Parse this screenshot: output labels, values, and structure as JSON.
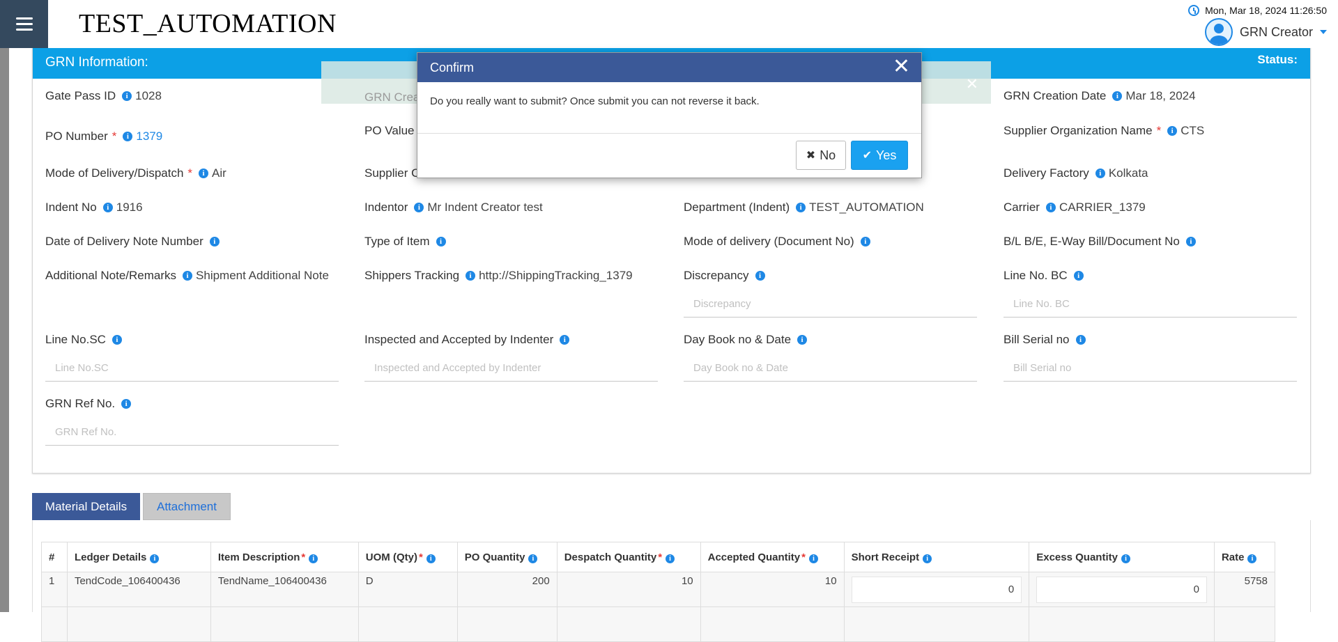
{
  "app": {
    "title": "TEST_AUTOMATION",
    "datetime": "Mon, Mar 18, 2024 11:26:50",
    "user": "GRN Creator"
  },
  "panel": {
    "title": "GRN Information:",
    "status_label": "Status:"
  },
  "alert": {
    "text": "GRN Creat"
  },
  "fields": {
    "gate_pass": {
      "label": "Gate Pass ID",
      "value": "1028"
    },
    "grn_creation_date": {
      "label": "GRN Creation Date",
      "value": "Mar 18, 2024"
    },
    "po_number": {
      "label": "PO Number",
      "value": "1379"
    },
    "po_value": {
      "label": "PO Value"
    },
    "supplier_org": {
      "label": "Supplier Organization Name",
      "value": "CTS"
    },
    "mode_delivery": {
      "label": "Mode of Delivery/Dispatch",
      "value": "Air"
    },
    "supplier_c": {
      "label": "Supplier C"
    },
    "delivery_factory": {
      "label": "Delivery Factory",
      "value": "Kolkata"
    },
    "indent_no": {
      "label": "Indent No",
      "value": "1916"
    },
    "indentor": {
      "label": "Indentor",
      "value": "Mr Indent Creator test"
    },
    "department": {
      "label": "Department (Indent)",
      "value": "TEST_AUTOMATION"
    },
    "carrier": {
      "label": "Carrier",
      "value": "CARRIER_1379"
    },
    "delivery_note": {
      "label": "Date of Delivery Note Number"
    },
    "type_item": {
      "label": "Type of Item"
    },
    "mode_doc": {
      "label": "Mode of delivery (Document No)"
    },
    "bl_be": {
      "label": "B/L B/E, E-Way Bill/Document No"
    },
    "additional_note": {
      "label": "Additional Note/Remarks",
      "value": "Shipment Additional Note"
    },
    "shippers_tracking": {
      "label": "Shippers Tracking",
      "value": "http://ShippingTracking_1379"
    },
    "discrepancy": {
      "label": "Discrepancy",
      "placeholder": "Discrepancy"
    },
    "line_bc": {
      "label": "Line No. BC",
      "placeholder": "Line No. BC"
    },
    "line_sc": {
      "label": "Line No.SC",
      "placeholder": "Line No.SC"
    },
    "inspected": {
      "label": "Inspected and Accepted by Indenter",
      "placeholder": "Inspected and Accepted by Indenter"
    },
    "day_book": {
      "label": "Day Book no & Date",
      "placeholder": "Day Book no & Date"
    },
    "bill_serial": {
      "label": "Bill Serial no",
      "placeholder": "Bill Serial no"
    },
    "grn_ref": {
      "label": "GRN Ref No.",
      "placeholder": "GRN Ref No."
    }
  },
  "tabs": [
    "Material Details",
    "Attachment"
  ],
  "table": {
    "headers": [
      "#",
      "Ledger Details",
      "Item Description",
      "UOM (Qty)",
      "PO Quantity",
      "Despatch Quantity",
      "Accepted Quantity",
      "Short Receipt",
      "Excess Quantity",
      "Rate"
    ],
    "rows": [
      {
        "n": "1",
        "ledger": "TendCode_106400436",
        "item": "TendName_106400436",
        "uom": "D",
        "po_qty": "200",
        "despatch": "10",
        "accepted": "10",
        "short": "0",
        "excess": "0",
        "rate": "5758"
      }
    ]
  },
  "modal": {
    "title": "Confirm",
    "message": "Do you really want to submit? Once submit you can not reverse it back.",
    "no_label": "No",
    "yes_label": "Yes"
  },
  "colors": {
    "header_blue": "#0ca0e6",
    "modal_blue": "#3b5998",
    "menu_dark": "#34495e",
    "yes_button": "#1aa1f0"
  }
}
